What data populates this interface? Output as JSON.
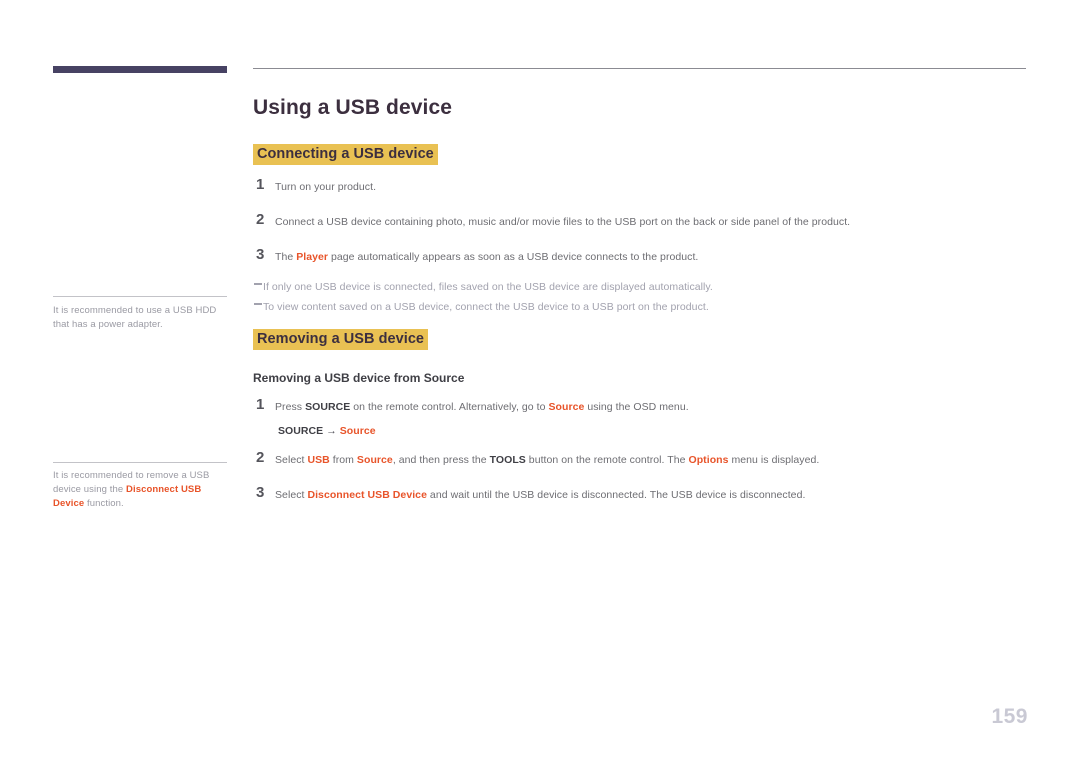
{
  "page": {
    "number": "159",
    "title": "Using a USB device"
  },
  "sections": {
    "connecting": {
      "heading": "Connecting a USB device",
      "steps": [
        {
          "num": "1",
          "html": "Turn on your product."
        },
        {
          "num": "2",
          "html": "Connect a USB device containing photo, music and/or movie files to the USB port on the back or side panel of the product."
        },
        {
          "num": "3",
          "html": "The <span class=\"accent\">Player</span> page automatically appears as soon as a USB device connects to the product."
        }
      ],
      "notes": [
        "If only one USB device is connected, files saved on the USB device are displayed automatically.",
        "To view content saved on a USB device, connect the USB device to a USB port on the product."
      ]
    },
    "removing": {
      "heading": "Removing a USB device",
      "subheading": "Removing a USB device from Source",
      "steps": [
        {
          "num": "1",
          "html": "Press <b class=\"kw\">SOURCE</b> on the remote control. Alternatively, go to <span class=\"accent\">Source</span> using the OSD menu."
        },
        {
          "num": "2",
          "html": "Select <span class=\"accent\">USB</span> from <span class=\"accent\">Source</span>, and then press the <b class=\"kw\">TOOLS</b> button on the remote control. The <span class=\"accent\">Options</span> menu is displayed."
        },
        {
          "num": "3",
          "html": "Select <span class=\"accent\">Disconnect USB Device</span> and wait until the USB device is disconnected. The USB device is disconnected."
        }
      ],
      "osd_path": {
        "source_key": "SOURCE",
        "arrow": "→",
        "target": "Source"
      }
    }
  },
  "margin_notes": [
    {
      "html": "It is recommended to use a USB HDD that has a power adapter."
    },
    {
      "html": "It is recommended to remove a USB device using the <span class=\"accent\">Disconnect USB Device</span> function."
    }
  ],
  "colors": {
    "accent_orange": "#e8542a",
    "highlight_yellow": "#e9c153",
    "title_plum": "#3c2f3f",
    "tab_navy": "#474263",
    "page_number_gray": "#c9c9d4"
  }
}
